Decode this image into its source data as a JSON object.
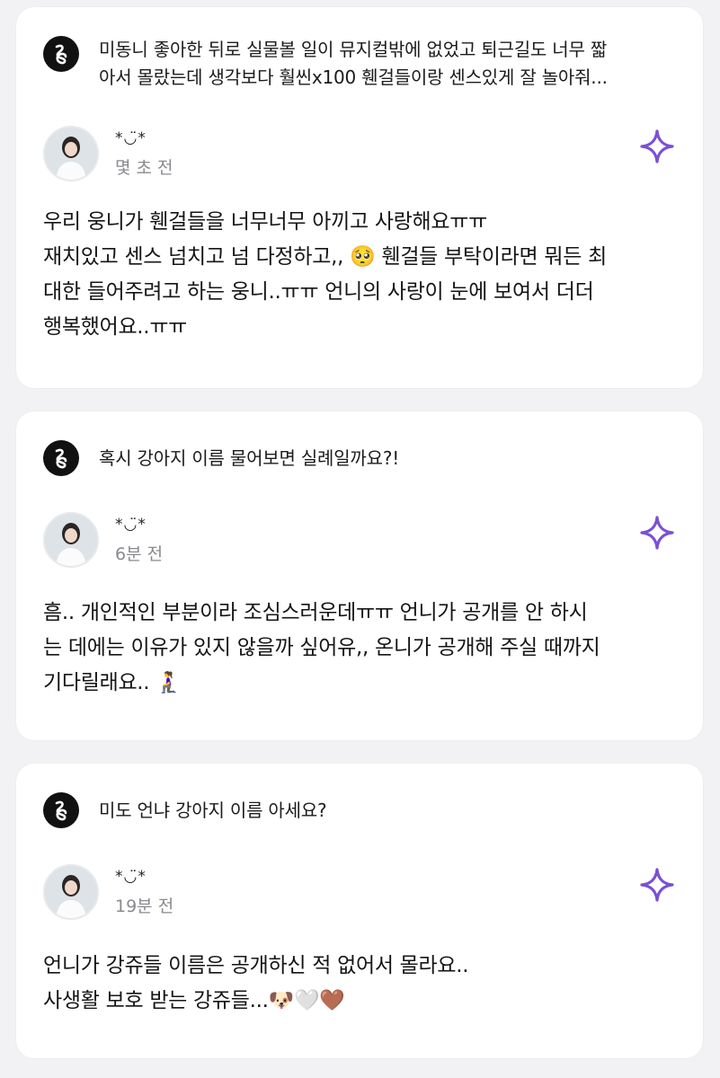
{
  "cards": [
    {
      "question": "미동니 좋아한 뒤로 실물볼 일이 뮤지컬밖에 없었고 퇴근길도 너무 짧\n아서 몰랐는데 생각보다 훨씬x100 휀걸들이랑 센스있게 잘 놀아줘...",
      "nickname": "*◡̈*",
      "time": "몇 초 전",
      "answer": "우리 웅니가 휀걸들을 너무너무 아끼고 사랑해요ㅠㅠ\n재치있고 센스 넘치고 넘 다정하고,, 🥺 휀걸들 부탁이라면 뭐든 최\n대한 들어주려고 하는 웅니..ㅠㅠ 언니의 사랑이 눈에 보여서 더더\n행복했어요..ㅠㅠ"
    },
    {
      "question": "혹시 강아지 이름 물어보면 실례일까요?!",
      "nickname": "*◡̈*",
      "time": "6분 전",
      "answer": "흠.. 개인적인 부분이라 조심스러운데ㅠㅠ 언니가 공개를 안 하시\n는 데에는 이유가 있지 않을까 싶어유,, 온니가 공개해 주실 때까지\n기다릴래요.. 🧎‍♀️"
    },
    {
      "question": "미도 언냐 강아지 이름 아세요?",
      "nickname": "*◡̈*",
      "time": "19분 전",
      "answer": "언니가 강쥬들 이름은 공개하신 적 없어서 몰라요..\n사생활 보호 받는 강쥬들...🐶🤍🤎"
    }
  ],
  "icons": {
    "logo": "app-logo-icon",
    "sparkle": "sparkle-icon"
  },
  "colors": {
    "background": "#f2f2f4",
    "card": "#ffffff",
    "sparkle": "#7b4fd6",
    "logo": "#111111",
    "time": "#8a8a8f"
  }
}
